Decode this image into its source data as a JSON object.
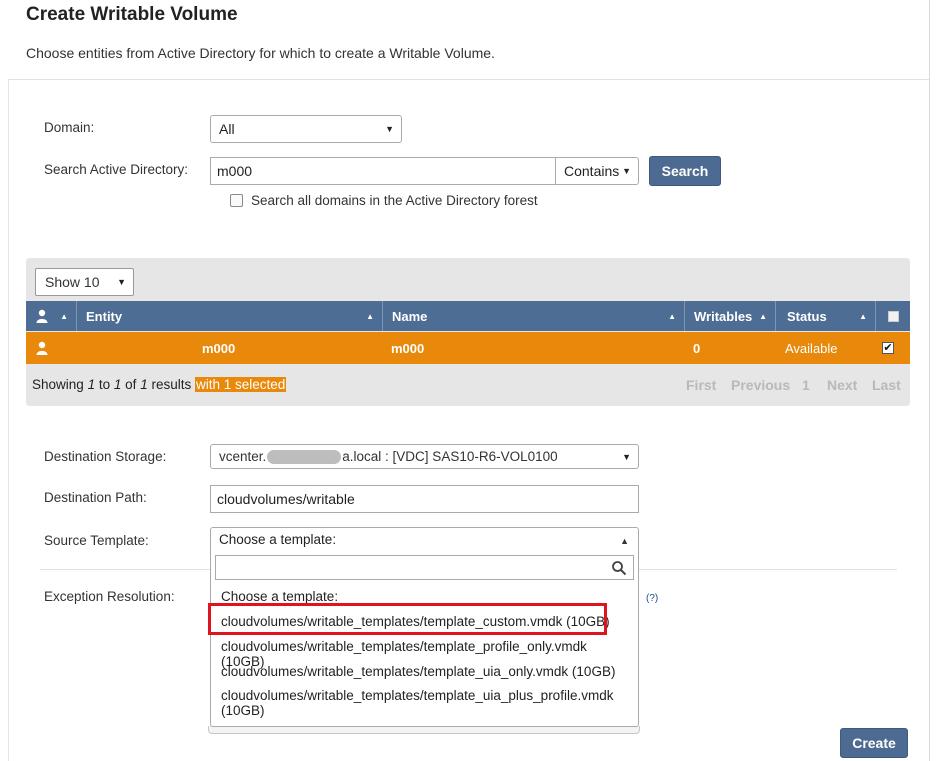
{
  "header": {
    "title": "Create Writable Volume",
    "subtitle": "Choose entities from Active Directory for which to create a Writable Volume."
  },
  "search_form": {
    "domain_label": "Domain:",
    "domain_value": "All",
    "search_label": "Search Active Directory:",
    "search_value": "m000",
    "match_mode": "Contains",
    "search_button": "Search",
    "all_domains_label": "Search all domains in the Active Directory forest",
    "all_domains_checked": false
  },
  "results": {
    "page_size": "Show 10",
    "columns": [
      "Entity",
      "Name",
      "Writables",
      "Status"
    ],
    "rows": [
      {
        "entity": "m000",
        "name": "m000",
        "writables": "0",
        "status": "Available",
        "selected": true
      }
    ],
    "summary": {
      "showing": "Showing",
      "from": "1",
      "to_word": "to",
      "to": "1",
      "of_word": "of",
      "total": "1",
      "results_word": "results",
      "selected_text": "with 1 selected"
    },
    "pager": {
      "first": "First",
      "previous": "Previous",
      "page": "1",
      "next": "Next",
      "last": "Last"
    }
  },
  "destination": {
    "storage_label": "Destination Storage:",
    "storage_value_prefix": "vcenter.",
    "storage_value_suffix": "a.local : [VDC] SAS10-R6-VOL0100",
    "path_label": "Destination Path:",
    "path_value": "cloudvolumes/writable",
    "template_label": "Source Template:",
    "exception_label": "Exception Resolution:",
    "help_link": "(?)"
  },
  "template_dropdown": {
    "current": "Choose a template:",
    "search_value": "",
    "options": [
      "Choose a template:",
      "cloudvolumes/writable_templates/template_custom.vmdk (10GB)",
      "cloudvolumes/writable_templates/template_profile_only.vmdk (10GB)",
      "cloudvolumes/writable_templates/template_uia_only.vmdk (10GB)",
      "cloudvolumes/writable_templates/template_uia_plus_profile.vmdk (10GB)"
    ],
    "highlighted_index": 1
  },
  "footer": {
    "create_button": "Create"
  },
  "colors": {
    "accent": "#4e6d94",
    "selected_row": "#e8890c",
    "highlight_box": "#e0141e"
  },
  "icons": [
    "user-icon",
    "sort-icon",
    "checkbox-icon",
    "search-icon",
    "caret-down-icon",
    "caret-up-icon"
  ]
}
